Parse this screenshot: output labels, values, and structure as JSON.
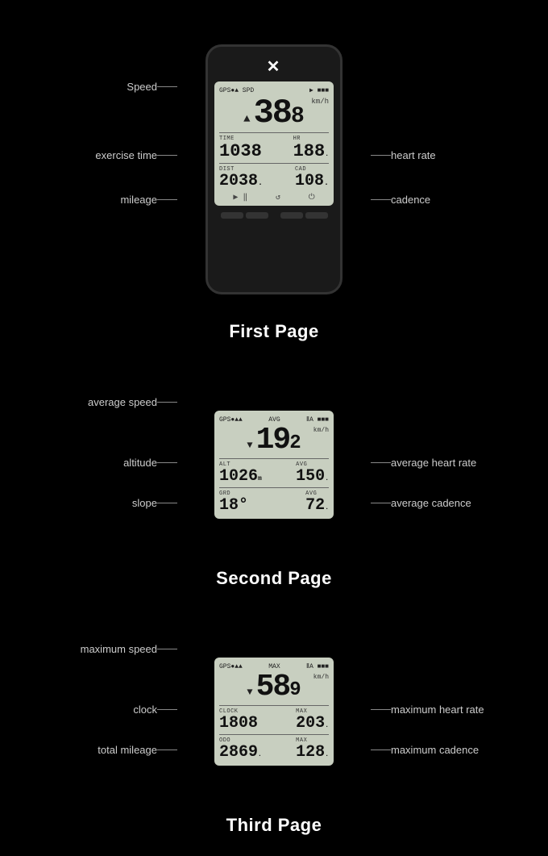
{
  "pages": [
    {
      "id": "first",
      "title": "First Page",
      "device": {
        "logo": "✕",
        "topbar": [
          "GPS●▲",
          "SPD",
          "▶",
          "■■■"
        ],
        "speed": "38",
        "speed_small": "8",
        "unit": "km/h",
        "time_label": "TIME",
        "time_val": "1038",
        "hr_label": "HR",
        "hr_val": "188",
        "hr_dot": ".",
        "dist_label": "DIST",
        "dist_val": "2038",
        "dist_dot": ".",
        "cad_label": "CAD",
        "cad_val": "108",
        "cad_dot": ".",
        "icons": [
          "▶ ‖",
          "↺",
          "⏻"
        ]
      },
      "annotations_left": [
        {
          "label": "Speed",
          "top_pct": 22
        },
        {
          "label": "exercise time",
          "top_pct": 48
        },
        {
          "label": "mileage",
          "top_pct": 67
        }
      ],
      "annotations_right": [
        {
          "label": "heart rate",
          "top_pct": 48
        },
        {
          "label": "cadence",
          "top_pct": 67
        }
      ]
    },
    {
      "id": "second",
      "title": "Second Page",
      "annotations_left": [
        {
          "label": "average speed",
          "top_pct": 22
        },
        {
          "label": "altitude",
          "top_pct": 52
        },
        {
          "label": "slope",
          "top_pct": 75
        }
      ],
      "annotations_right": [
        {
          "label": "average heart rate",
          "top_pct": 52
        },
        {
          "label": "average cadence",
          "top_pct": 75
        }
      ],
      "device": {
        "topbar_left": "GPS▲▲",
        "topbar_mid": "AVG",
        "topbar_hr": "ⅡA",
        "topbar_bat": "■■■",
        "avg_speed": "19",
        "avg_speed_sm": "2",
        "unit": "km/h",
        "alt_label": "ALT",
        "alt_val": "1026",
        "alt_dot": "m",
        "avg_label": "AVG",
        "avg_val": "150",
        "avg_dot": ".",
        "grd_label": "GRD",
        "grd_val": "18°",
        "avg2_label": "AVG",
        "avg2_val": "72",
        "avg2_dot": "."
      }
    },
    {
      "id": "third",
      "title": "Third Page",
      "annotations_left": [
        {
          "label": "maximum speed",
          "top_pct": 22
        },
        {
          "label": "clock",
          "top_pct": 52
        },
        {
          "label": "total mileage",
          "top_pct": 75
        }
      ],
      "annotations_right": [
        {
          "label": "maximum heart rate",
          "top_pct": 52
        },
        {
          "label": "maximum cadence",
          "top_pct": 75
        }
      ],
      "device": {
        "topbar_left": "GPS▲▲",
        "topbar_mid": "MAX",
        "topbar_hr": "ⅡA",
        "topbar_bat": "■■■",
        "max_speed": "58",
        "max_speed_sm": "9",
        "unit": "km/h",
        "clock_label": "CLOCK",
        "clock_val": "1808",
        "max_label": "MAX",
        "max_val": "203",
        "max_dot": ".",
        "odo_label": "ODO",
        "odo_val": "2869",
        "odo_dot": ".",
        "max2_label": "MAX",
        "max2_val": "128",
        "max2_dot": "."
      }
    }
  ]
}
